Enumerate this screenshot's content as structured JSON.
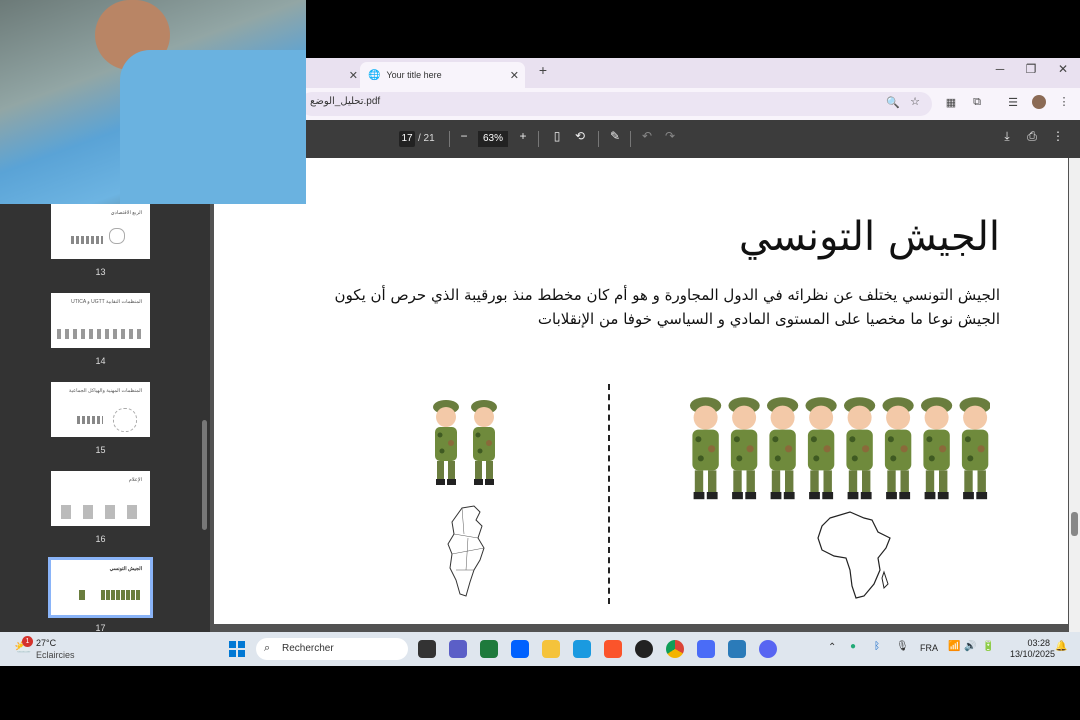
{
  "browser": {
    "tabs": [
      {
        "title": "",
        "close": "✕"
      },
      {
        "title": "Your title here",
        "close": "✕"
      }
    ],
    "new_tab": "+",
    "window": {
      "minimize": "─",
      "restore": "❐",
      "close": "✕"
    },
    "address": "تحليل_الوضع.pdf"
  },
  "pdf_toolbar": {
    "current_page": "17",
    "total_pages": "/ 21",
    "zoom": "63%",
    "zoom_out": "−",
    "zoom_in": "+"
  },
  "sidebar": {
    "thumbnails": [
      {
        "num": "13",
        "title": "الربع الاقتصادي"
      },
      {
        "num": "14",
        "title": "UTICA و UGTT المنظمات النقابية"
      },
      {
        "num": "15",
        "title": "المنظمات المهنية والهياكل الجماعية"
      },
      {
        "num": "16",
        "title": "الإعلام"
      },
      {
        "num": "17",
        "title": "الجيش التونسي",
        "selected": true
      }
    ]
  },
  "slide": {
    "title": "الجيش التونسي",
    "body": "الجيش التونسي يختلف عن نظرائه في الدول المجاورة و هو أم كان مخطط منذ بورقيبة الذي حرص أن يكون الجيش نوعا ما مخصيا على المستوى المادي و السياسي خوفا من الإنقلابات",
    "left_soldiers": 2,
    "right_soldiers": 8
  },
  "taskbar": {
    "weather_temp": "27°C",
    "weather_desc": "Eclaircies",
    "weather_badge": "1",
    "search_placeholder": "Rechercher",
    "language": "FRA",
    "time": "03:28",
    "date": "13/10/2025"
  },
  "colors": {
    "pdf_toolbar": "#3c3c3c",
    "sidebar": "#333333",
    "tab_strip": "#e9e1f0",
    "taskbar": "#dfe6ee"
  }
}
